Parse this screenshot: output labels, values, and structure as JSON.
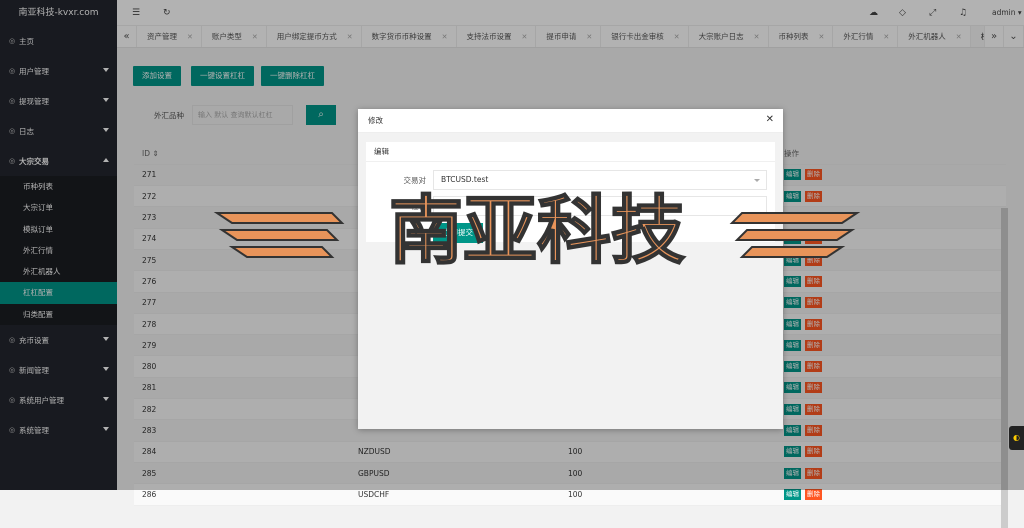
{
  "brand": "南亚科技-kvxr.com",
  "sidebar": {
    "items": [
      {
        "label": "主页",
        "icon": "home-icon"
      },
      {
        "label": "用户管理",
        "icon": "user-icon"
      },
      {
        "label": "提现管理",
        "icon": "user-icon"
      },
      {
        "label": "日志",
        "icon": "log-icon"
      },
      {
        "label": "大宗交易",
        "icon": "trade-icon"
      }
    ],
    "sub": [
      "币种列表",
      "大宗订单",
      "模拟订单",
      "外汇行情",
      "外汇机器人",
      "杠杠配置",
      "归类配置"
    ],
    "items2": [
      {
        "label": "充币设置",
        "icon": "coin-icon"
      },
      {
        "label": "新闻管理",
        "icon": "news-icon"
      },
      {
        "label": "系统用户管理",
        "icon": "user-icon"
      },
      {
        "label": "系统管理",
        "icon": "gear-icon"
      }
    ]
  },
  "topbar": {
    "user": "admin"
  },
  "tabs": [
    "资产管理",
    "账户类型",
    "用户绑定提币方式",
    "数字货币币种设置",
    "支持法币设置",
    "提币申请",
    "银行卡出金审核",
    "大宗账户日志",
    "币种列表",
    "外汇行情",
    "外汇机器人",
    "杠杠配置"
  ],
  "toolbar": {
    "add": "添加设置",
    "set": "一键设置杠杠",
    "del": "一键删除杠杠"
  },
  "search": {
    "label": "外汇品种",
    "placeholder": "输入 默认 查询默认杠杠"
  },
  "table": {
    "headers": [
      "ID ⇕",
      "",
      "",
      "操作"
    ],
    "rows": [
      [
        "271",
        "",
        ""
      ],
      [
        "272",
        "",
        ""
      ],
      [
        "273",
        "",
        ""
      ],
      [
        "274",
        "",
        ""
      ],
      [
        "275",
        "",
        ""
      ],
      [
        "276",
        "",
        ""
      ],
      [
        "277",
        "",
        ""
      ],
      [
        "278",
        "",
        ""
      ],
      [
        "279",
        "",
        ""
      ],
      [
        "280",
        "",
        ""
      ],
      [
        "281",
        "",
        ""
      ],
      [
        "282",
        "",
        ""
      ],
      [
        "283",
        "",
        ""
      ],
      [
        "284",
        "NZDUSD",
        "100"
      ],
      [
        "285",
        "GBPUSD",
        "100"
      ],
      [
        "286",
        "USDCHF",
        "100"
      ]
    ],
    "edit": "编辑",
    "delete": "删除"
  },
  "modal": {
    "title": "修改",
    "card_title": "编辑",
    "pair_label": "交易对",
    "pair_value": "BTCUSD.test",
    "lever_label": "杠杆",
    "lever_value": "100",
    "submit": "立即提交"
  },
  "watermark": "南亚科技",
  "colors": {
    "accent": "#009688",
    "danger": "#ff5722",
    "sidebar": "#23262e"
  }
}
